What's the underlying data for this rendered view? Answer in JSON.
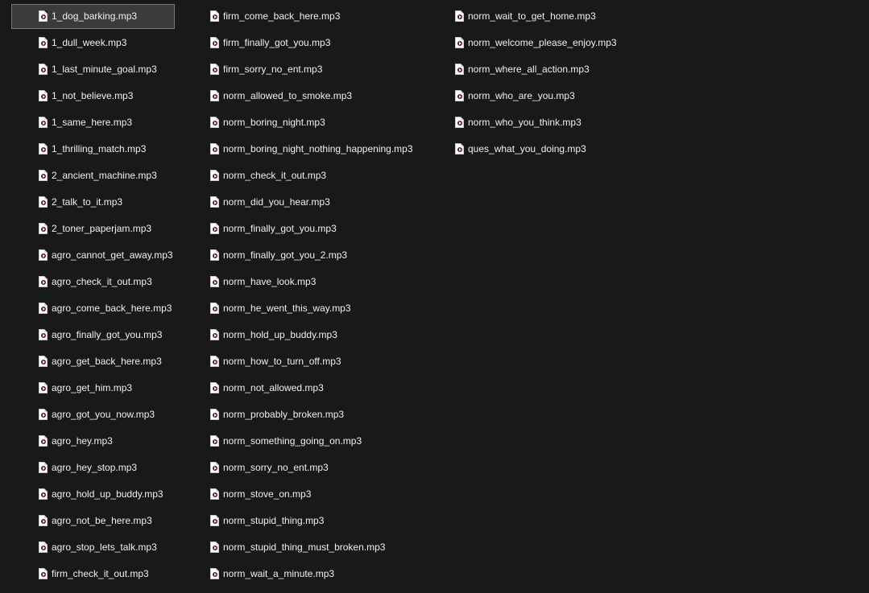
{
  "columns": [
    {
      "files": [
        {
          "name": "1_dog_barking.mp3",
          "selected": true
        },
        {
          "name": "1_dull_week.mp3"
        },
        {
          "name": "1_last_minute_goal.mp3"
        },
        {
          "name": "1_not_believe.mp3"
        },
        {
          "name": "1_same_here.mp3"
        },
        {
          "name": "1_thrilling_match.mp3"
        },
        {
          "name": "2_ancient_machine.mp3"
        },
        {
          "name": "2_talk_to_it.mp3"
        },
        {
          "name": "2_toner_paperjam.mp3"
        },
        {
          "name": "agro_cannot_get_away.mp3"
        },
        {
          "name": "agro_check_it_out.mp3"
        },
        {
          "name": "agro_come_back_here.mp3"
        },
        {
          "name": "agro_finally_got_you.mp3"
        },
        {
          "name": "agro_get_back_here.mp3"
        },
        {
          "name": "agro_get_him.mp3"
        },
        {
          "name": "agro_got_you_now.mp3"
        },
        {
          "name": "agro_hey.mp3"
        },
        {
          "name": "agro_hey_stop.mp3"
        },
        {
          "name": "agro_hold_up_buddy.mp3"
        },
        {
          "name": "agro_not_be_here.mp3"
        },
        {
          "name": "agro_stop_lets_talk.mp3"
        },
        {
          "name": "firm_check_it_out.mp3"
        }
      ]
    },
    {
      "files": [
        {
          "name": "firm_come_back_here.mp3"
        },
        {
          "name": "firm_finally_got_you.mp3"
        },
        {
          "name": "firm_sorry_no_ent.mp3"
        },
        {
          "name": "norm_allowed_to_smoke.mp3"
        },
        {
          "name": "norm_boring_night.mp3"
        },
        {
          "name": "norm_boring_night_nothing_happening.mp3"
        },
        {
          "name": "norm_check_it_out.mp3"
        },
        {
          "name": "norm_did_you_hear.mp3"
        },
        {
          "name": "norm_finally_got_you.mp3"
        },
        {
          "name": "norm_finally_got_you_2.mp3"
        },
        {
          "name": "norm_have_look.mp3"
        },
        {
          "name": "norm_he_went_this_way.mp3"
        },
        {
          "name": "norm_hold_up_buddy.mp3"
        },
        {
          "name": "norm_how_to_turn_off.mp3"
        },
        {
          "name": "norm_not_allowed.mp3"
        },
        {
          "name": "norm_probably_broken.mp3"
        },
        {
          "name": "norm_something_going_on.mp3"
        },
        {
          "name": "norm_sorry_no_ent.mp3"
        },
        {
          "name": "norm_stove_on.mp3"
        },
        {
          "name": "norm_stupid_thing.mp3"
        },
        {
          "name": "norm_stupid_thing_must_broken.mp3"
        },
        {
          "name": "norm_wait_a_minute.mp3"
        }
      ]
    },
    {
      "files": [
        {
          "name": "norm_wait_to_get_home.mp3"
        },
        {
          "name": "norm_welcome_please_enjoy.mp3"
        },
        {
          "name": "norm_where_all_action.mp3"
        },
        {
          "name": "norm_who_are_you.mp3"
        },
        {
          "name": "norm_who_you_think.mp3"
        },
        {
          "name": "ques_what_you_doing.mp3"
        }
      ]
    }
  ],
  "icon": "audio-file-icon",
  "colors": {
    "background": "#191919",
    "text": "#f0f0f0",
    "selection_bg": "#3b3b3b",
    "selection_border": "#777777"
  }
}
